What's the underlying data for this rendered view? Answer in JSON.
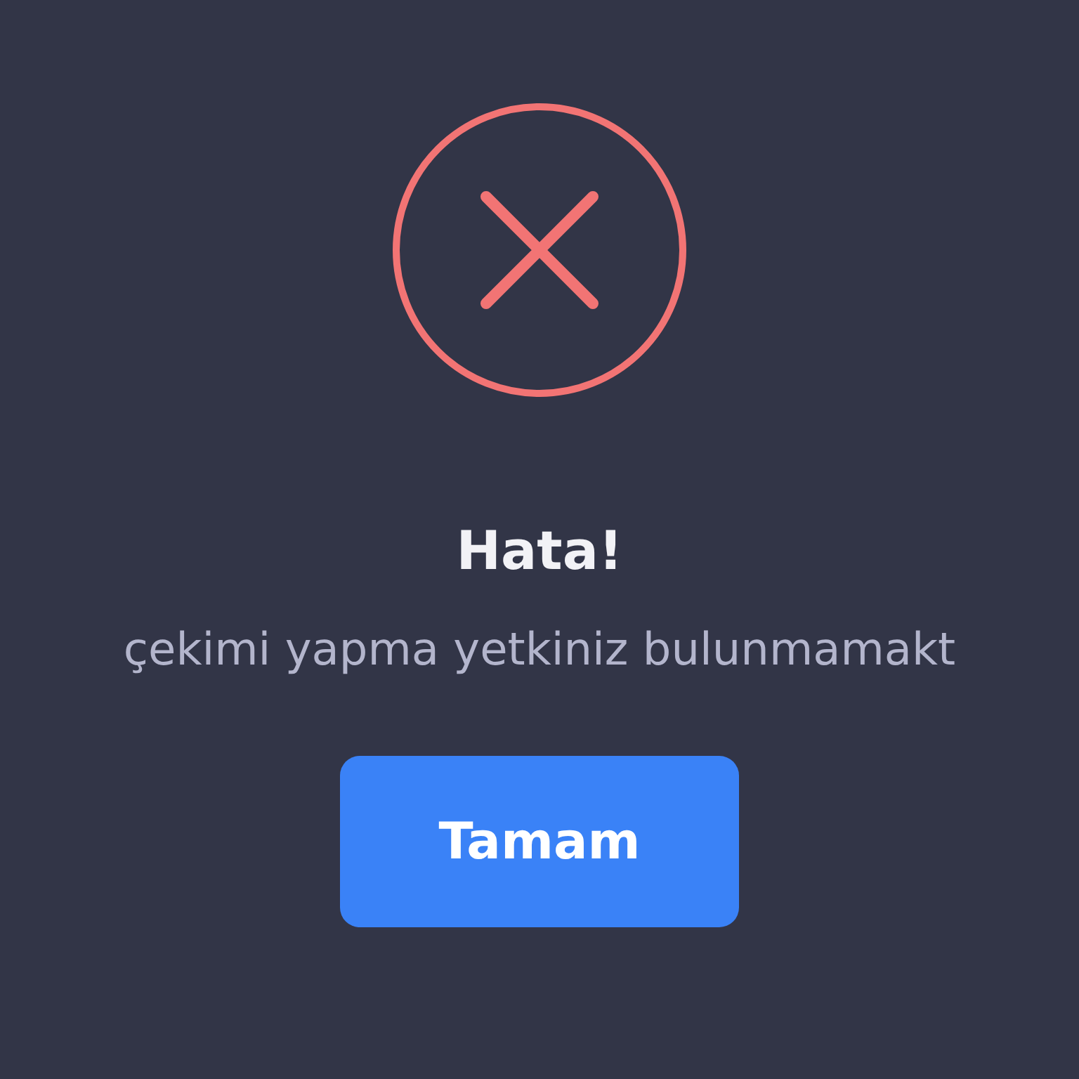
{
  "dialog": {
    "title": "Hata!",
    "message": "çekimi yapma yetkiniz bulunmamakt",
    "buttons": [
      {
        "label": "Tamam",
        "kind": "primary"
      }
    ]
  }
}
